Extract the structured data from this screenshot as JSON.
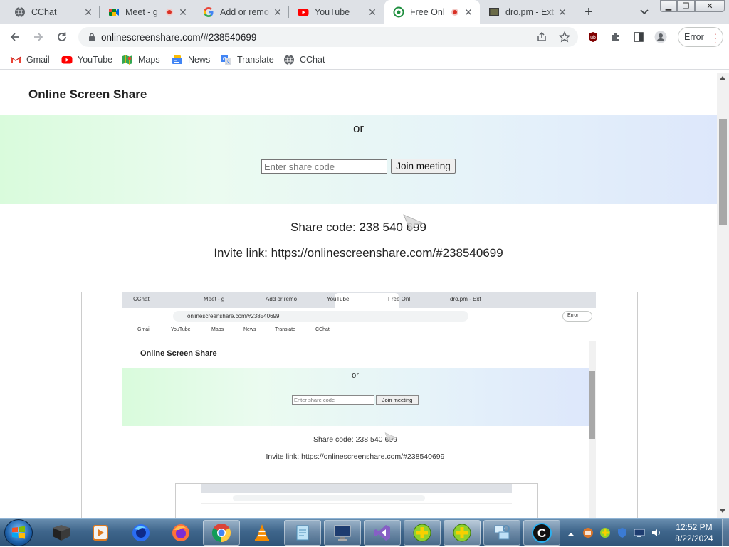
{
  "browser": {
    "tabs": [
      {
        "title": "CChat",
        "favicon": "globe-icon",
        "recording": false,
        "active": false
      },
      {
        "title": "Meet - g",
        "favicon": "google-meet-icon",
        "recording": true,
        "active": false
      },
      {
        "title": "Add or remo",
        "favicon": "google-g-icon",
        "recording": false,
        "active": false
      },
      {
        "title": "YouTube",
        "favicon": "youtube-icon",
        "recording": false,
        "active": false
      },
      {
        "title": "Free Onl",
        "favicon": "screenshare-icon",
        "recording": true,
        "active": true
      },
      {
        "title": "dro.pm - Ext",
        "favicon": "dropm-icon",
        "recording": false,
        "active": false
      }
    ],
    "new_tab_label": "+",
    "tab_search_label": "⌄",
    "window_controls": {
      "minimize": "▁",
      "restore": "❐",
      "close": "✕"
    },
    "address": {
      "url": "onlinescreenshare.com/#238540699"
    },
    "profile_error_label": "Error",
    "bookmarks": [
      {
        "label": "Gmail",
        "icon": "gmail-icon"
      },
      {
        "label": "YouTube",
        "icon": "youtube-icon"
      },
      {
        "label": "Maps",
        "icon": "maps-icon"
      },
      {
        "label": "News",
        "icon": "news-icon"
      },
      {
        "label": "Translate",
        "icon": "translate-icon"
      },
      {
        "label": "CChat",
        "icon": "globe-icon"
      }
    ]
  },
  "page": {
    "site_title": "Online Screen Share",
    "or_label": "or",
    "share_input_placeholder": "Enter share code",
    "join_button_label": "Join meeting",
    "share_code_text": "Share code: 238 540 699",
    "invite_link_text": "Invite link: https://onlinescreenshare.com/#238540699"
  },
  "preview": {
    "tabs": [
      "CChat",
      "Meet - g",
      "Add or remo",
      "YouTube",
      "Free Onl",
      "dro.pm - Ext"
    ],
    "url": "onlinescreenshare.com/#238540699",
    "error_label": "Error",
    "bookmarks": [
      "Gmail",
      "YouTube",
      "Maps",
      "News",
      "Translate",
      "CChat"
    ],
    "site_title": "Online Screen Share",
    "or_label": "or",
    "share_input_placeholder": "Enter share code",
    "join_button_label": "Join meeting",
    "share_code_text": "Share code: 238 540 699",
    "invite_link_text": "Invite link: https://onlinescreenshare.com/#238540699"
  },
  "taskbar": {
    "apps": [
      "start-orb",
      "terminal-app",
      "media-player-app",
      "firefox-dev-app",
      "firefox-app",
      "chrome-app",
      "vlc-app",
      "notepad-app",
      "remote-desktop-app",
      "visual-studio-app",
      "plus-app",
      "plus-app-active",
      "network-app",
      "cchat-app"
    ],
    "time": "12:52 PM",
    "date": "8/22/2024"
  }
}
